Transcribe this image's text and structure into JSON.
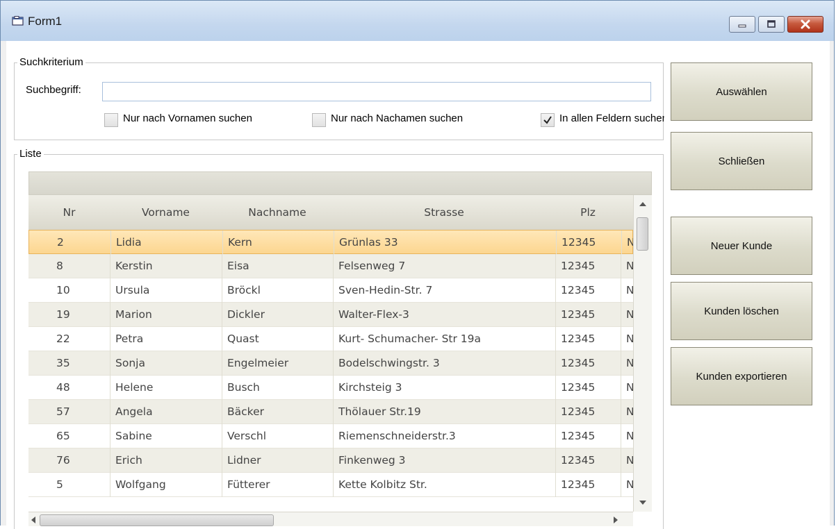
{
  "window": {
    "title": "Form1"
  },
  "search_group": {
    "legend": "Suchkriterium",
    "label": "Suchbegriff:",
    "input_value": "",
    "checkboxes": [
      {
        "label": "Nur nach Vornamen suchen",
        "checked": false
      },
      {
        "label": "Nur nach Nachamen suchen",
        "checked": false
      },
      {
        "label": "In allen Feldern suchen",
        "checked": true
      }
    ]
  },
  "list_group": {
    "legend": "Liste"
  },
  "buttons": {
    "select": "Auswählen",
    "close": "Schließen",
    "new_customer": "Neuer Kunde",
    "delete_customer": "Kunden löschen",
    "export_customers": "Kunden exportieren"
  },
  "table": {
    "columns": [
      "Nr",
      "Vorname",
      "Nachname",
      "Strasse",
      "Plz"
    ],
    "rows": [
      [
        "2",
        "Lidia",
        "Kern",
        "Grünlas 33",
        "12345"
      ],
      [
        "8",
        "Kerstin",
        "Eisa",
        "Felsenweg 7",
        "12345"
      ],
      [
        "10",
        "Ursula",
        "Bröckl",
        "Sven-Hedin-Str. 7",
        "12345"
      ],
      [
        "19",
        "Marion",
        "Dickler",
        "Walter-Flex-3",
        "12345"
      ],
      [
        "22",
        "Petra",
        "Quast",
        "Kurt- Schumacher- Str 19a",
        "12345"
      ],
      [
        "35",
        "Sonja",
        "Engelmeier",
        "Bodelschwingstr. 3",
        "12345"
      ],
      [
        "48",
        "Helene",
        "Busch",
        "Kirchsteig 3",
        "12345"
      ],
      [
        "57",
        "Angela",
        "Bäcker",
        "Thölauer Str.19",
        "12345"
      ],
      [
        "65",
        "Sabine",
        "Verschl",
        "Riemenschneiderstr.3",
        "12345"
      ],
      [
        "76",
        "Erich",
        "Lidner",
        "Finkenweg 3",
        "12345"
      ],
      [
        "5",
        "Wolfgang",
        "Fütterer",
        "Kette Kolbitz Str.",
        "12345"
      ]
    ],
    "overflow_glyph": "N",
    "selected_row": 0
  },
  "colors": {
    "selected_row": "#fcd690",
    "alt_row": "#efeee6",
    "button_face": "#dcdbcb"
  }
}
